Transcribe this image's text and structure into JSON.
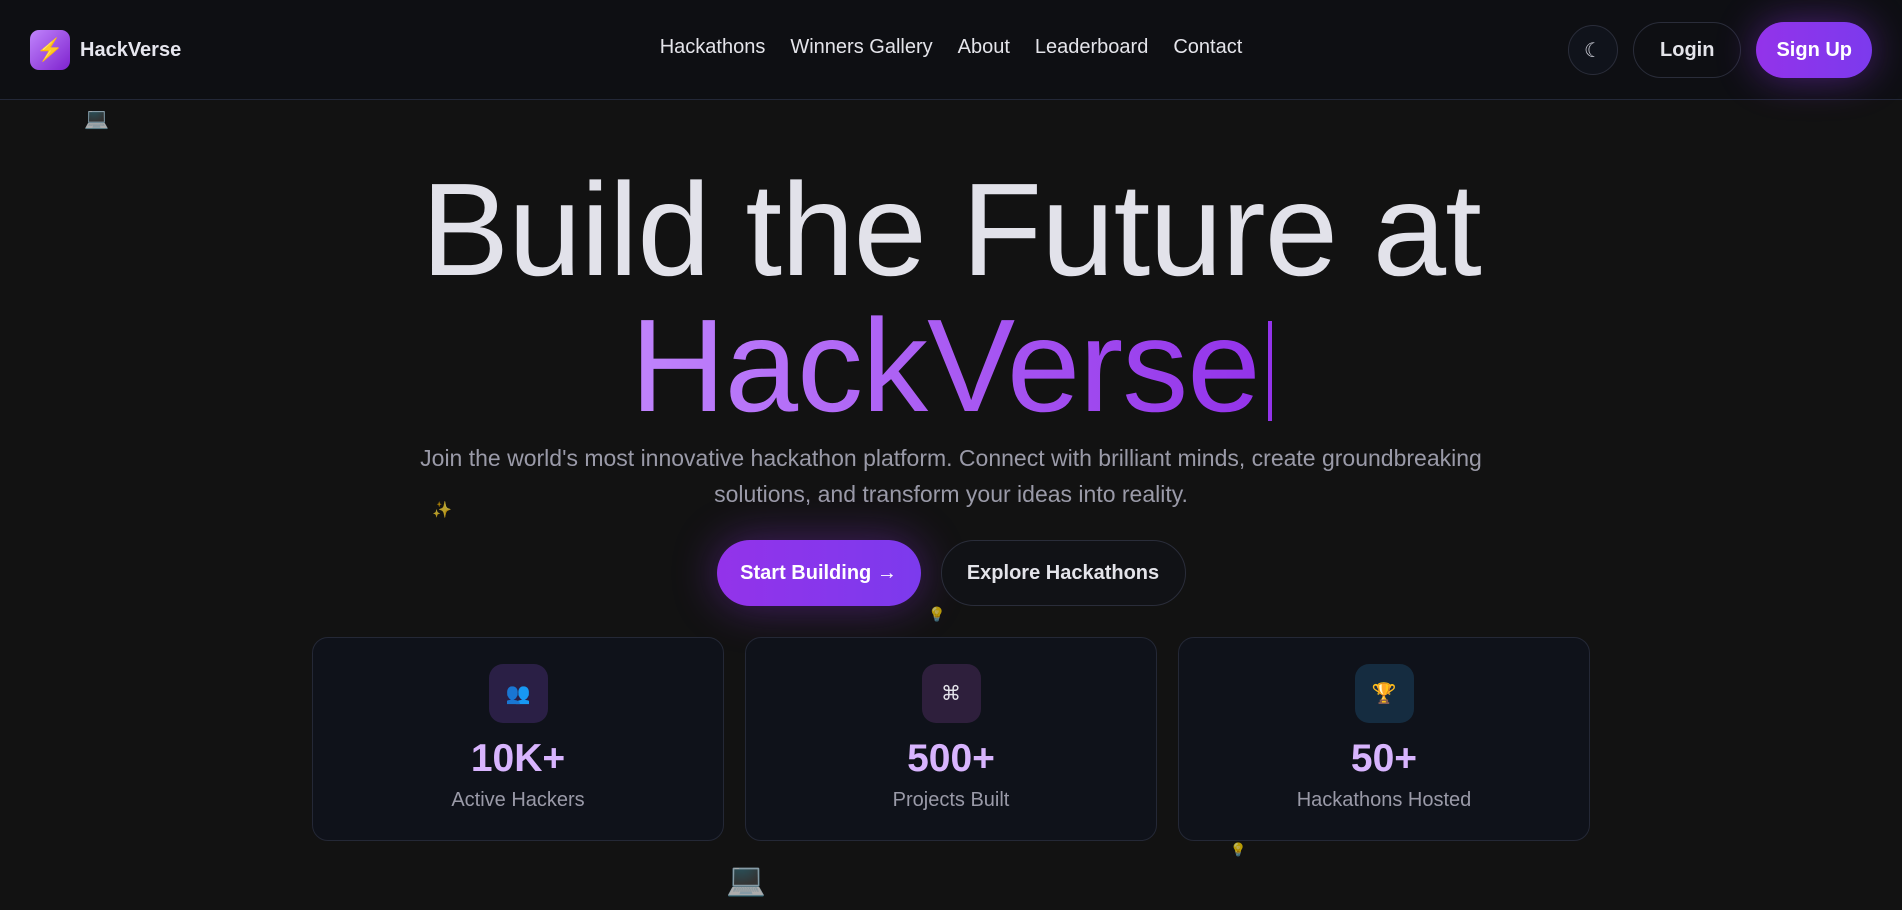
{
  "nav": {
    "brand": "HackVerse",
    "links": [
      "Hackathons",
      "Winners Gallery",
      "About",
      "Leaderboard",
      "Contact"
    ],
    "theme_icon": "☾",
    "login": "Login",
    "signup": "Sign Up"
  },
  "hero": {
    "line1": "Build the Future at",
    "line2": "HackVerse",
    "subtitle": "Join the world's most innovative hackathon platform. Connect with brilliant minds, create groundbreaking solutions, and transform your ideas into reality.",
    "primary": "Start Building →",
    "secondary": "Explore Hackathons"
  },
  "stats": [
    {
      "icon": "👥",
      "value": "10K+",
      "label": "Active Hackers",
      "bg": "#2a1f45"
    },
    {
      "icon": "⌘",
      "value": "500+",
      "label": "Projects Built",
      "bg": "#2e1f3c"
    },
    {
      "icon": "🏆",
      "value": "50+",
      "label": "Hackathons Hosted",
      "bg": "#152c40"
    }
  ],
  "colors": {
    "accent": "#9333ea",
    "stat": "#d8b4fe"
  }
}
